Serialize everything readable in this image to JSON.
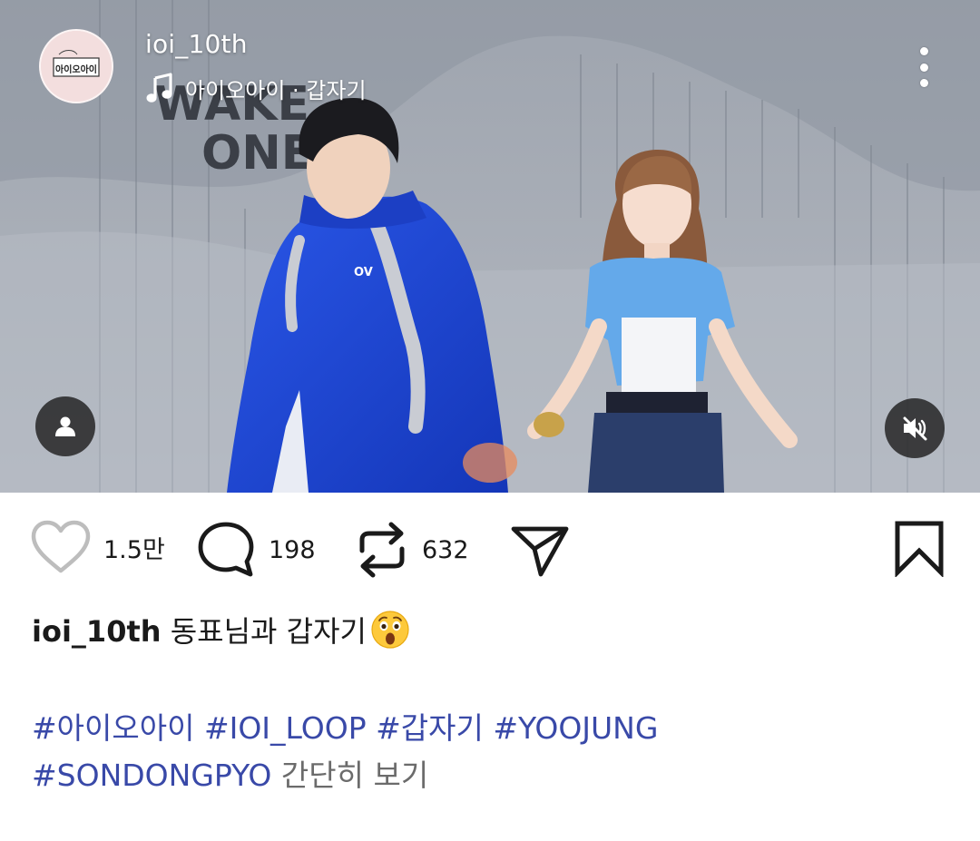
{
  "post": {
    "username": "ioi_10th",
    "avatar_text": "아이오아이",
    "music": "아이오아이 · 갑자기",
    "stats": {
      "likes": "1.5만",
      "comments": "198",
      "reposts": "632"
    },
    "caption": {
      "username": "ioi_10th",
      "text": "동표님과 갑자기"
    },
    "hashtags": [
      "#아이오아이",
      "#IOI_LOOP",
      "#갑자기",
      "#YOOJUNG",
      "#SONDONGPYO"
    ],
    "see_less": "간단히 보기",
    "video_backdrop_text": [
      "WAKE",
      "ONE"
    ],
    "jacket_logo": "OV"
  },
  "icons": {
    "more": "more-vertical-icon",
    "music": "music-note-icon",
    "tag_people": "person-icon",
    "mute": "speaker-muted-icon",
    "like": "heart-icon",
    "comment": "comment-bubble-icon",
    "repost": "repost-icon",
    "share": "paper-plane-icon",
    "bookmark": "bookmark-icon",
    "emoji": "astonished-face-emoji"
  },
  "colors": {
    "hashtag": "#3949a8",
    "text": "#1a1a1a",
    "muted_text": "#6b6b6b",
    "overlay_button": "#202020"
  }
}
